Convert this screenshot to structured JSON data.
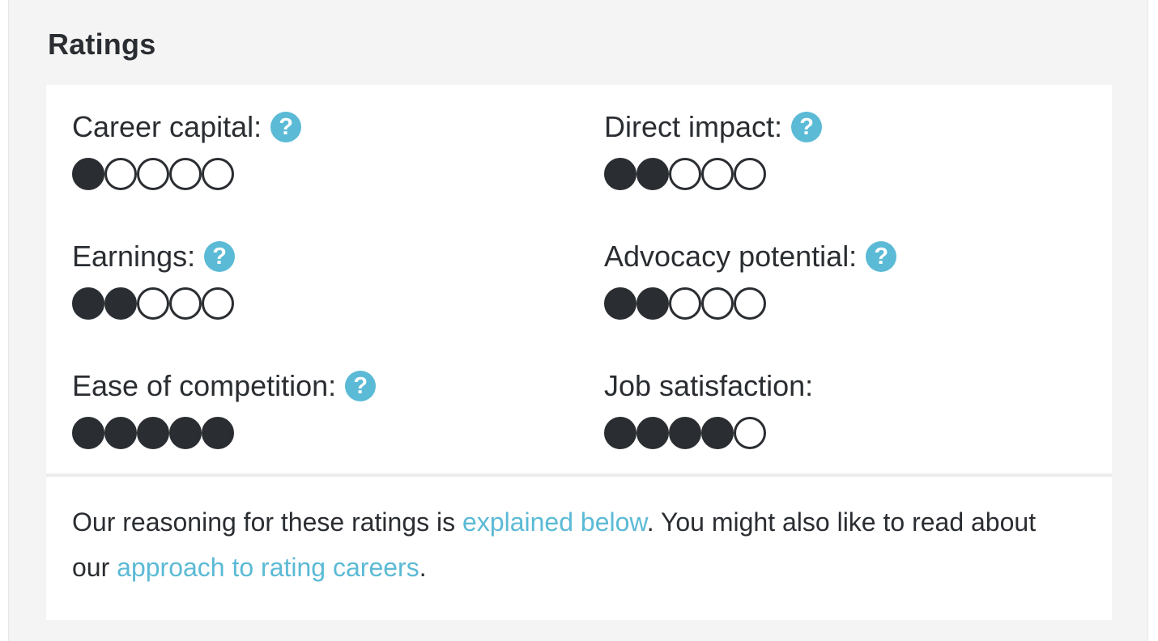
{
  "section": {
    "title": "Ratings"
  },
  "ratings": [
    {
      "label": "Career capital:",
      "help": "?",
      "score": 1,
      "max": 5,
      "has_help": true
    },
    {
      "label": "Direct impact:",
      "help": "?",
      "score": 2,
      "max": 5,
      "has_help": true
    },
    {
      "label": "Earnings:",
      "help": "?",
      "score": 2,
      "max": 5,
      "has_help": true
    },
    {
      "label": "Advocacy potential:",
      "help": "?",
      "score": 2,
      "max": 5,
      "has_help": true
    },
    {
      "label": "Ease of competition:",
      "help": "?",
      "score": 5,
      "max": 5,
      "has_help": true
    },
    {
      "label": "Job satisfaction:",
      "help": "",
      "score": 4,
      "max": 5,
      "has_help": false
    }
  ],
  "reasoning": {
    "text_1": "Our reasoning for these ratings is ",
    "link_1": "explained below",
    "text_2": ". You might also like to read about our ",
    "link_2": "approach to rating careers",
    "text_3": "."
  },
  "colors": {
    "accent": "#5bbad5",
    "dot": "#2a2d31",
    "panel_bg": "#f4f4f4",
    "card_bg": "#ffffff"
  },
  "icons": {
    "help": "question-circle-icon"
  }
}
